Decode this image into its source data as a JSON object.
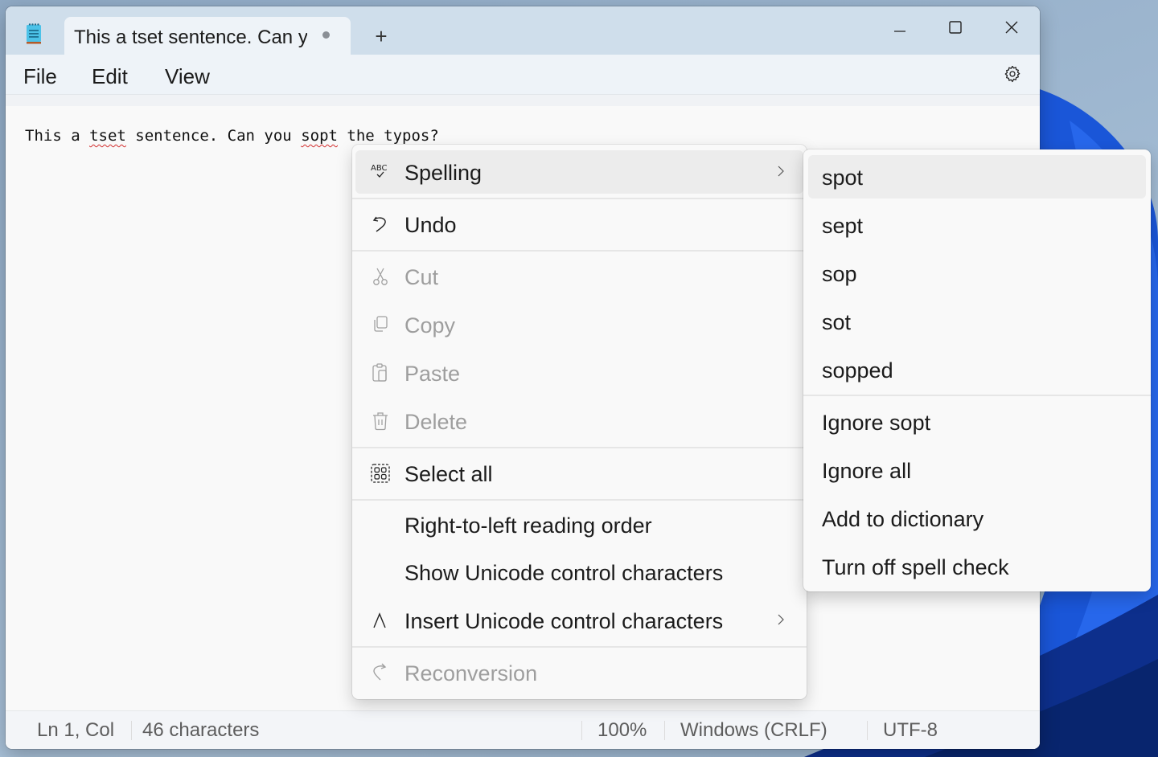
{
  "window": {
    "tab_title": "This a tset sentence. Can you sopt the typos?",
    "tab_unsaved_indicator": "unsaved-dot",
    "new_tab_label": "+",
    "controls": [
      "minimize-icon",
      "maximize-icon",
      "close-icon"
    ]
  },
  "menubar": {
    "items": [
      "File",
      "Edit",
      "View"
    ],
    "settings_icon": "gear-icon"
  },
  "editor": {
    "segments": [
      {
        "text": "This a ",
        "misspelled": false
      },
      {
        "text": "tset",
        "misspelled": true
      },
      {
        "text": " sentence. Can you ",
        "misspelled": false
      },
      {
        "text": "sopt",
        "misspelled": true
      },
      {
        "text": " the typos?",
        "misspelled": false
      }
    ]
  },
  "context_menu": {
    "items": [
      {
        "label": "Spelling",
        "icon": "spell-check-icon",
        "disabled": false,
        "submenu": true,
        "highlighted": true
      },
      {
        "label": "Undo",
        "icon": "undo-icon",
        "disabled": false
      },
      {
        "label": "Cut",
        "icon": "scissors-icon",
        "disabled": true
      },
      {
        "label": "Copy",
        "icon": "copy-icon",
        "disabled": true
      },
      {
        "label": "Paste",
        "icon": "paste-icon",
        "disabled": true
      },
      {
        "label": "Delete",
        "icon": "trash-icon",
        "disabled": true
      },
      {
        "label": "Select all",
        "icon": "select-all-icon",
        "disabled": false
      },
      {
        "label": "Right-to-left reading order",
        "icon": "",
        "disabled": false
      },
      {
        "label": "Show Unicode control characters",
        "icon": "",
        "disabled": false
      },
      {
        "label": "Insert Unicode control characters",
        "icon": "caret-icon",
        "disabled": false,
        "submenu": true
      },
      {
        "label": "Reconversion",
        "icon": "reconversion-icon",
        "disabled": true
      }
    ]
  },
  "spelling_submenu": {
    "suggestions": [
      "spot",
      "sept",
      "sop",
      "sot",
      "sopped"
    ],
    "actions": [
      "Ignore sopt",
      "Ignore all",
      "Add to dictionary",
      "Turn off spell check"
    ]
  },
  "statusbar": {
    "position": "Ln 1, Col",
    "characters": "46 characters",
    "zoom": "100%",
    "line_ending": "Windows (CRLF)",
    "encoding": "UTF-8"
  },
  "colors": {
    "titlebar": "#cfdeeb",
    "menubar": "#eef3f8",
    "misspell_underline": "#d32f2f",
    "wallpaper_accent": "#1f5fd6"
  }
}
